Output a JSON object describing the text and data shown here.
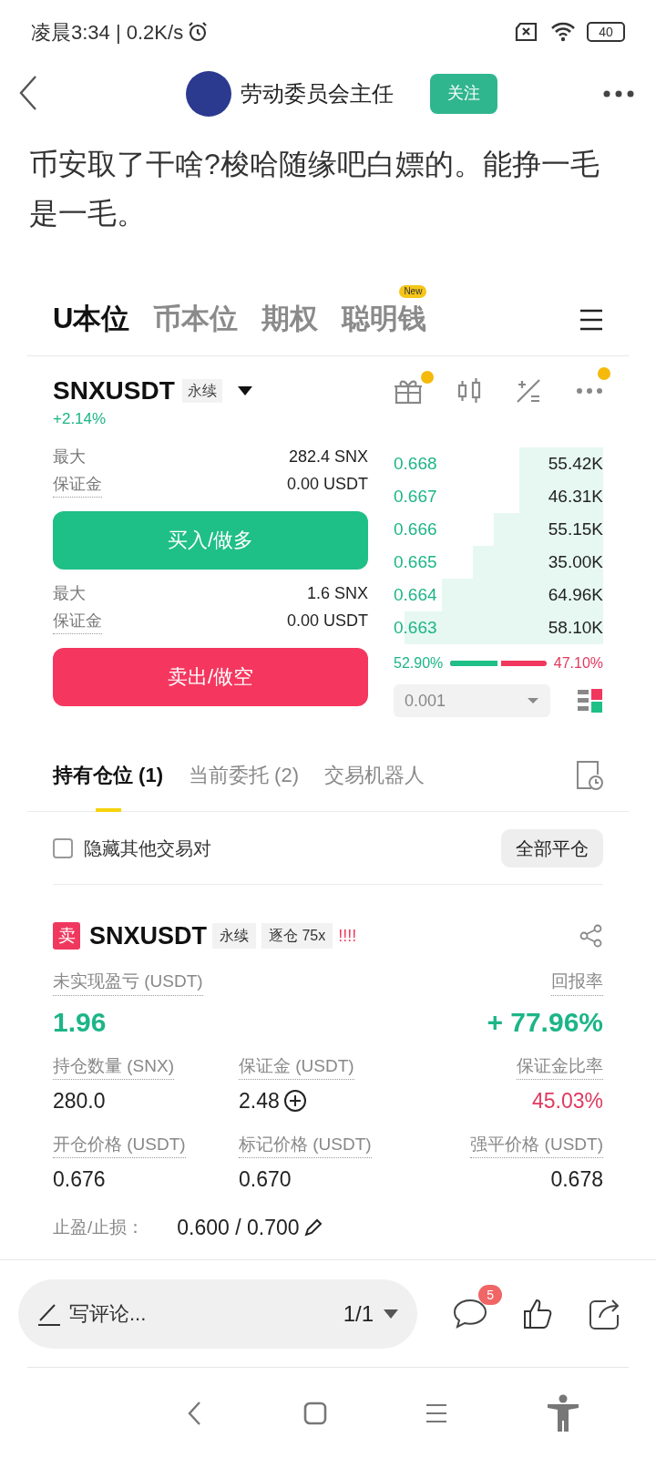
{
  "status_bar": {
    "time": "凌晨3:34 | 0.2K/s",
    "battery": "40"
  },
  "header": {
    "author": "劳动委员会主任",
    "follow": "关注"
  },
  "post": {
    "text": "币安取了干啥?梭哈随缘吧白嫖的。能挣一毛是一毛。"
  },
  "market_tabs": [
    {
      "label": "U本位",
      "selected": true
    },
    {
      "label": "币本位",
      "selected": false
    },
    {
      "label": "期权",
      "selected": false
    },
    {
      "label": "聪明钱",
      "selected": false,
      "badge": "New"
    }
  ],
  "symbol": {
    "name": "SNXUSDT",
    "tag": "永续",
    "change": "+2.14%"
  },
  "buy": {
    "max_label": "最大",
    "max_value": "282.4 SNX",
    "margin_label": "保证金",
    "margin_value": "0.00 USDT",
    "button": "买入/做多"
  },
  "sell": {
    "max_label": "最大",
    "max_value": "1.6 SNX",
    "margin_label": "保证金",
    "margin_value": "0.00 USDT",
    "button": "卖出/做空"
  },
  "order_book": [
    {
      "price": "0.668",
      "amount": "55.42K"
    },
    {
      "price": "0.667",
      "amount": "46.31K"
    },
    {
      "price": "0.666",
      "amount": "55.15K"
    },
    {
      "price": "0.665",
      "amount": "35.00K"
    },
    {
      "price": "0.664",
      "amount": "64.96K"
    },
    {
      "price": "0.663",
      "amount": "58.10K"
    }
  ],
  "ratio": {
    "buy": "52.90%",
    "sell": "47.10%",
    "level": 0.529
  },
  "precision": "0.001",
  "position_tabs": [
    {
      "label": "持有仓位 (1)",
      "selected": true
    },
    {
      "label": "当前委托 (2)",
      "selected": false
    },
    {
      "label": "交易机器人",
      "selected": false
    }
  ],
  "hide_others": {
    "label": "隐藏其他交易对",
    "checked": false
  },
  "close_all": "全部平仓",
  "position": {
    "side": "卖",
    "symbol": "SNXUSDT",
    "tags": [
      "永续",
      "逐仓 75x"
    ],
    "warning": "!!!!",
    "pnl_label": "未实现盈亏 (USDT)",
    "pnl": "1.96",
    "roe_label": "回报率",
    "roe": "+ 77.96%",
    "fields": [
      {
        "label": "持仓数量 (SNX)",
        "value": "280.0"
      },
      {
        "label": "保证金 (USDT)",
        "value": "2.48",
        "kind": "add"
      },
      {
        "label": "保证金比率",
        "value": "45.03%",
        "kind": "alert"
      },
      {
        "label": "开仓价格 (USDT)",
        "value": "0.676"
      },
      {
        "label": "标记价格 (USDT)",
        "value": "0.670"
      },
      {
        "label": "强平价格 (USDT)",
        "value": "0.678"
      }
    ],
    "tpsl_label": "止盈/止损：",
    "tpsl": "0.600 / 0.700"
  },
  "comment_bar": {
    "placeholder": "写评论...",
    "page": "1/1",
    "comments": "5"
  }
}
